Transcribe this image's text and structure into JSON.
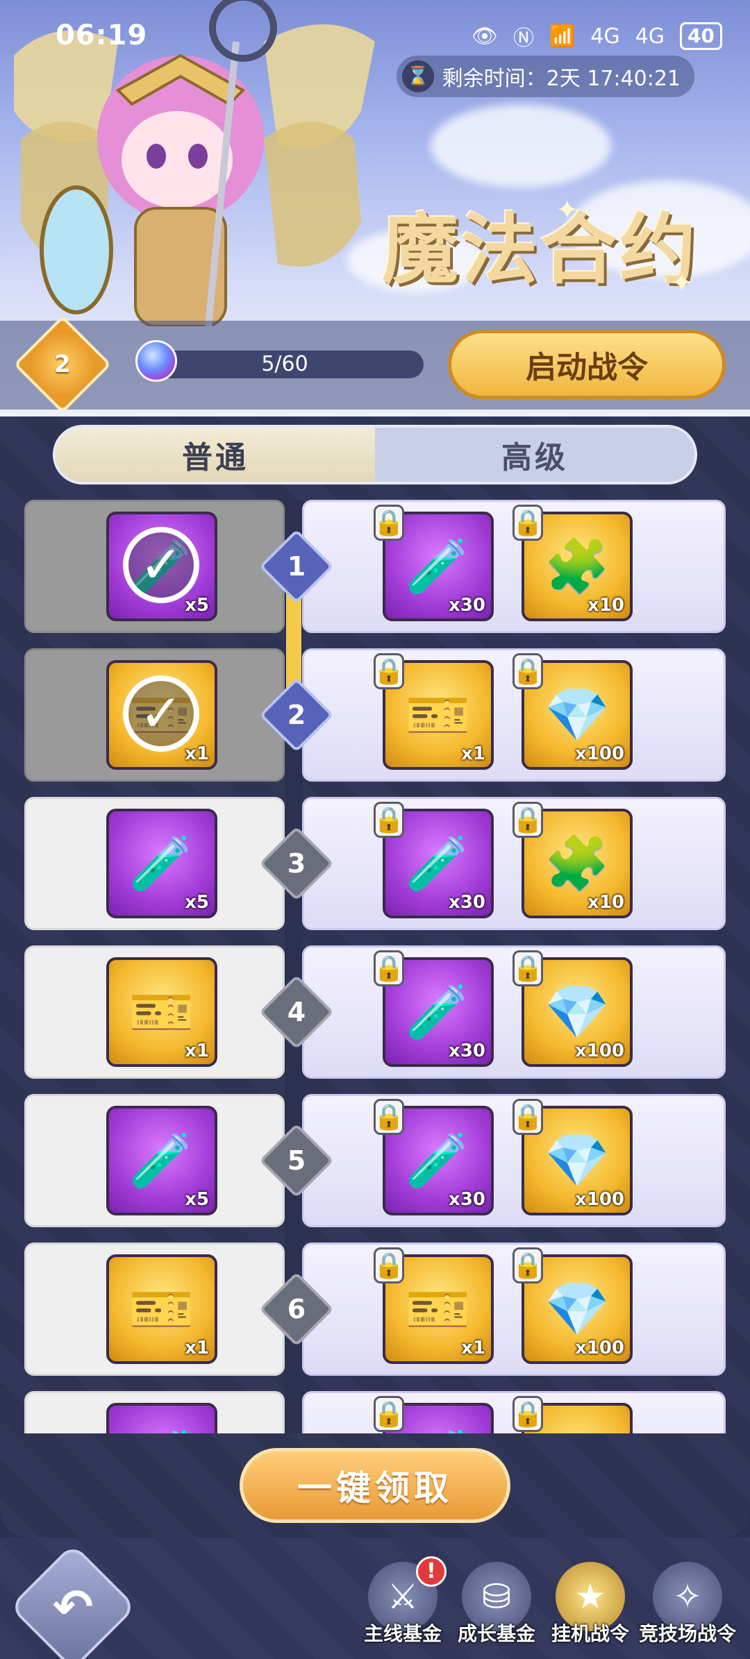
{
  "status_bar": {
    "time": "06:19",
    "signal_labels": [
      "4G",
      "4G"
    ],
    "battery": "40"
  },
  "header": {
    "timer_text": "剩余时间：2天 17:40:21",
    "title": "魔法合约",
    "level": "2",
    "progress_text": "5/60",
    "progress_fraction": 0.083,
    "start_button": "启动战令"
  },
  "tabs": [
    {
      "label": "普通",
      "active": true
    },
    {
      "label": "高级",
      "active": false
    }
  ],
  "rows": [
    {
      "level": "1",
      "claimed": true,
      "free": {
        "type": "potion",
        "color": "purple",
        "qty": "x5"
      },
      "premium": [
        {
          "type": "potion",
          "color": "purple",
          "qty": "x30"
        },
        {
          "type": "puzzle",
          "color": "gold",
          "qty": "x10"
        }
      ]
    },
    {
      "level": "2",
      "claimed": true,
      "free": {
        "type": "ticket",
        "color": "gold",
        "qty": "x1"
      },
      "premium": [
        {
          "type": "ticket",
          "color": "gold",
          "qty": "x1"
        },
        {
          "type": "gem",
          "color": "gold",
          "qty": "x100"
        }
      ]
    },
    {
      "level": "3",
      "claimed": false,
      "free": {
        "type": "potion",
        "color": "purple",
        "qty": "x5"
      },
      "premium": [
        {
          "type": "potion",
          "color": "purple",
          "qty": "x30"
        },
        {
          "type": "puzzle",
          "color": "gold",
          "qty": "x10"
        }
      ]
    },
    {
      "level": "4",
      "claimed": false,
      "free": {
        "type": "ticket",
        "color": "gold",
        "qty": "x1"
      },
      "premium": [
        {
          "type": "potion",
          "color": "purple",
          "qty": "x30"
        },
        {
          "type": "gem",
          "color": "gold",
          "qty": "x100"
        }
      ]
    },
    {
      "level": "5",
      "claimed": false,
      "free": {
        "type": "potion",
        "color": "purple",
        "qty": "x5"
      },
      "premium": [
        {
          "type": "potion",
          "color": "purple",
          "qty": "x30"
        },
        {
          "type": "gem",
          "color": "gold",
          "qty": "x100"
        }
      ]
    },
    {
      "level": "6",
      "claimed": false,
      "free": {
        "type": "ticket",
        "color": "gold",
        "qty": "x1"
      },
      "premium": [
        {
          "type": "ticket",
          "color": "gold",
          "qty": "x1"
        },
        {
          "type": "gem",
          "color": "gold",
          "qty": "x100"
        }
      ]
    },
    {
      "level": "",
      "claimed": false,
      "free": {
        "type": "potion",
        "color": "purple",
        "qty": ""
      },
      "premium": [
        {
          "type": "potion",
          "color": "purple",
          "qty": ""
        },
        {
          "type": "ticket",
          "color": "gold",
          "qty": ""
        }
      ]
    }
  ],
  "claim_all_button": "一键领取",
  "bottom_nav": [
    {
      "label": "主线基金",
      "icon": "sword-stone-icon",
      "badge": "!",
      "active": false
    },
    {
      "label": "成长基金",
      "icon": "coin-stack-icon",
      "badge": "",
      "active": false
    },
    {
      "label": "挂机战令",
      "icon": "shield-star-icon",
      "badge": "",
      "active": true
    },
    {
      "label": "竞技场战令",
      "icon": "arena-wings-icon",
      "badge": "",
      "active": false
    }
  ],
  "colors": {
    "accent_gold": "#f0b640",
    "panel_bg": "#2e3354",
    "item_purple": "#a23dd8",
    "item_gold": "#f5b82e"
  }
}
